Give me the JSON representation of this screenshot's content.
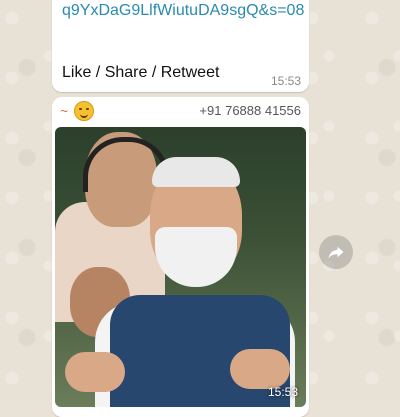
{
  "messages": [
    {
      "link_text": "q9YxDaG9LlfWiutuDA9sgQ&s=08",
      "body": "Like / Share / Retweet",
      "time": "15:53"
    },
    {
      "sender_prefix": "~",
      "sender_phone": "+91 76888 41556",
      "time": "15:53",
      "media_type": "video"
    }
  ],
  "icons": {
    "forward": "forward-arrow-icon",
    "emoji": "smiling-face-icon"
  },
  "colors": {
    "link": "#2a8ab0",
    "sender_name": "#d17a3a",
    "bubble": "#ffffff",
    "chat_background": "#e8e1d5"
  }
}
